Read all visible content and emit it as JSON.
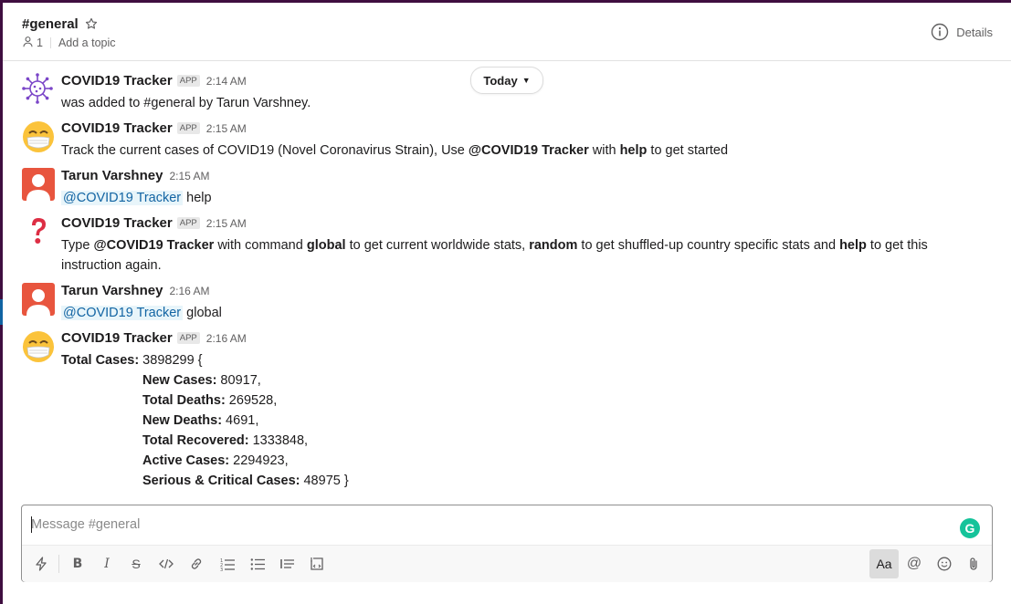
{
  "header": {
    "channel": "#general",
    "member_count": "1",
    "topic_placeholder": "Add a topic",
    "details_label": "Details"
  },
  "date_divider": "Today",
  "messages": [
    {
      "sender": "COVID19 Tracker",
      "badge": "APP",
      "time": "2:14 AM",
      "text": "was added to #general by Tarun Varshney."
    },
    {
      "sender": "COVID19 Tracker",
      "badge": "APP",
      "time": "2:15 AM",
      "text_pre": "Track the current cases of COVID19 (Novel Coronavirus Strain), Use ",
      "bold1": "@COVID19 Tracker",
      "text_mid": " with ",
      "bold2": "help",
      "text_post": " to get started"
    },
    {
      "sender": "Tarun Varshney",
      "time": "2:15 AM",
      "mention": "@COVID19 Tracker",
      "text": " help"
    },
    {
      "sender": "COVID19 Tracker",
      "badge": "APP",
      "time": "2:15 AM",
      "t1": "Type ",
      "b1": "@COVID19 Tracker",
      "t2": " with command ",
      "b2": "global",
      "t3": " to get current worldwide stats, ",
      "b3": "random",
      "t4": " to get shuffled-up country specific stats and ",
      "b4": "help",
      "t5": " to get this",
      "t6": "instruction again."
    },
    {
      "sender": "Tarun Varshney",
      "time": "2:16 AM",
      "mention": "@COVID19 Tracker",
      "text": " global"
    },
    {
      "sender": "COVID19 Tracker",
      "badge": "APP",
      "time": "2:16 AM",
      "stats": [
        {
          "label": "Total Cases:",
          "value": " 3898299 {"
        },
        {
          "label": "New Cases:",
          "value": " 80917,"
        },
        {
          "label": "Total Deaths:",
          "value": " 269528,"
        },
        {
          "label": "New Deaths:",
          "value": " 4691,"
        },
        {
          "label": "Total Recovered:",
          "value": " 1333848,"
        },
        {
          "label": "Active Cases:",
          "value": " 2294923,"
        },
        {
          "label": "Serious & Critical Cases:",
          "value": " 48975 }"
        }
      ]
    }
  ],
  "composer": {
    "placeholder": "Message #general",
    "grammarly": "G",
    "aa_label": "Aa",
    "bold_label": "B",
    "italic_label": "I",
    "strike_label": "S",
    "mention_label": "@"
  },
  "colors": {
    "sidebar": "#3f0e40",
    "link": "#1264a3",
    "grammarly": "#15c39a",
    "avatar_red": "#e8553e"
  }
}
